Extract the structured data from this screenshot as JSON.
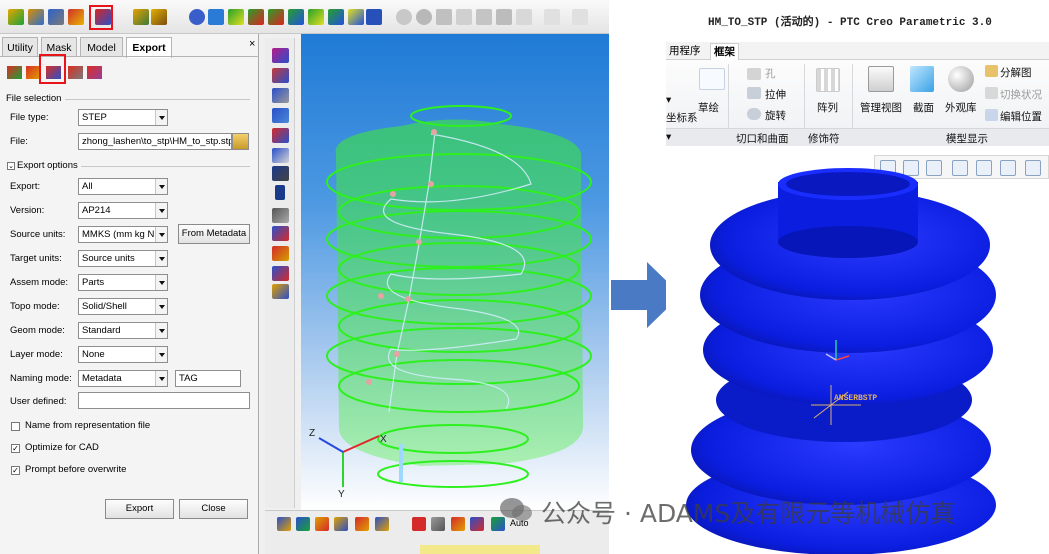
{
  "hypermesh": {
    "panel": {
      "tabs": [
        "Utility",
        "Mask",
        "Model",
        "Export"
      ],
      "active_tab": "Export",
      "close_glyph": "×",
      "file_selection": {
        "heading": "File selection",
        "file_type_label": "File type:",
        "file_type_value": "STEP",
        "file_label": "File:",
        "file_value": "zhong_lashen\\to_stp\\HM_to_stp.stp"
      },
      "export_options": {
        "heading": "Export options",
        "rows": [
          {
            "label": "Export:",
            "value": "All"
          },
          {
            "label": "Version:",
            "value": "AP214"
          },
          {
            "label": "Source units:",
            "value": "MMKS (mm kg N s)"
          },
          {
            "label": "Target units:",
            "value": "Source units"
          },
          {
            "label": "Assem mode:",
            "value": "Parts"
          },
          {
            "label": "Topo mode:",
            "value": "Solid/Shell"
          },
          {
            "label": "Geom mode:",
            "value": "Standard"
          },
          {
            "label": "Layer mode:",
            "value": "None"
          },
          {
            "label": "Naming mode:",
            "value": "Metadata"
          }
        ],
        "from_metadata_button": "From Metadata",
        "naming_tag_value": "TAG",
        "user_defined_label": "User defined:",
        "user_defined_value": "",
        "checkboxes": [
          {
            "label": "Name from representation file",
            "checked": false
          },
          {
            "label": "Optimize for CAD",
            "checked": true
          },
          {
            "label": "Prompt before overwrite",
            "checked": true
          }
        ]
      },
      "buttons": {
        "export": "Export",
        "close": "Close"
      }
    },
    "viewport": {
      "axis_labels": {
        "z": "Z",
        "x": "X",
        "y": "Y"
      },
      "mesh_color": "#2ef01e"
    },
    "bottom_toolbar": {
      "auto_label": "Auto"
    },
    "highlight_color": "#e8141b"
  },
  "arrow_color": "#4a7ac4",
  "creo": {
    "window_title": "HM_TO_STP (活动的) - PTC Creo Parametric 3.0",
    "tabs": [
      {
        "label": "用程序",
        "active": false
      },
      {
        "label": "框架",
        "active": true
      }
    ],
    "ribbon": {
      "partial_left_label": "坐标系",
      "sketch_label": "草绘",
      "cut_items": [
        "孔",
        "拉伸",
        "旋转"
      ],
      "pattern_label": "阵列",
      "manage_view_label": "管理视图",
      "section_label": "截面",
      "appearance_label": "外观库",
      "right_items": [
        "分解图",
        "切换状况",
        "编辑位置"
      ],
      "groups": [
        "切口和曲面",
        "修饰符",
        "模型显示"
      ]
    },
    "model": {
      "color": "#0b1ee0",
      "label": "ANSERBSTP"
    }
  },
  "watermark": {
    "text": "公众号 · ADAMS及有限元等机械仿真"
  }
}
